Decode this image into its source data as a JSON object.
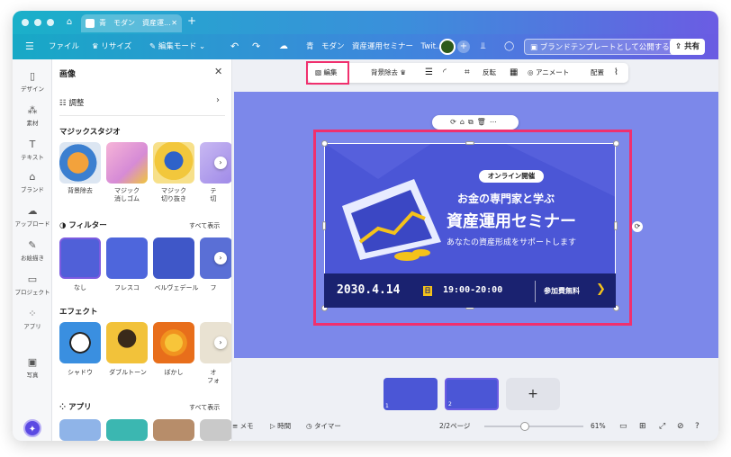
{
  "tab": {
    "title": "青　モダン　資産運..."
  },
  "menubar": {
    "file": "ファイル",
    "resize": "リサイズ",
    "edit_mode": "編集モード",
    "doc_title": "青　モダン　資産運用セミナー　Twit...",
    "publish": "ブランドテンプレートとして公開する",
    "share": "共有"
  },
  "rail": [
    {
      "icon": "layout-icon",
      "label": "デザイン"
    },
    {
      "icon": "elements-icon",
      "label": "素材"
    },
    {
      "icon": "text-icon",
      "label": "テキスト"
    },
    {
      "icon": "brand-icon",
      "label": "ブランド"
    },
    {
      "icon": "upload-icon",
      "label": "アップロード"
    },
    {
      "icon": "draw-icon",
      "label": "お絵描き"
    },
    {
      "icon": "folder-icon",
      "label": "プロジェクト"
    },
    {
      "icon": "apps-icon",
      "label": "アプリ"
    },
    {
      "icon": "photo-icon",
      "label": "写真"
    }
  ],
  "panel": {
    "title": "画像",
    "adjust": "調整",
    "magic_studio": "マジックスタジオ",
    "magic_items": [
      "背景除去",
      "マジック\n消しゴム",
      "マジック\n切り抜き",
      "テ\n切"
    ],
    "filter": "フィルター",
    "filter_see_all": "すべて表示",
    "filter_items": [
      "なし",
      "フレスコ",
      "ベルヴェデール",
      "フ"
    ],
    "effect": "エフェクト",
    "effect_items": [
      "シャドウ",
      "ダブルトーン",
      "ぼかし",
      "オ\nフォ"
    ],
    "apps": "アプリ",
    "apps_see_all": "すべて表示"
  },
  "toolbar": {
    "edit": "編集",
    "bg_remove": "背景除去",
    "flip": "反転",
    "animate": "アニメート",
    "position": "配置"
  },
  "design": {
    "pill": "オンライン開催",
    "subtitle": "お金の専門家と学ぶ",
    "title": "資産運用セミナー",
    "description": "あなたの資産形成をサポートします",
    "date": "2030.4.14",
    "day": "日",
    "time": "19:00-20:00",
    "fee": "参加費無料"
  },
  "pages": {
    "first_num": "1",
    "second_num": "2",
    "add": "+"
  },
  "bottombar": {
    "notes": "メモ",
    "duration": "時間",
    "timer": "タイマー",
    "page_indicator": "2/2ページ",
    "zoom": "61%"
  },
  "colors": {
    "accent": "#f0306e",
    "canvas_bg": "#7c88ea",
    "design_bg": "#4b56d6",
    "strip": "#1a2270",
    "gold": "#f4c21b"
  }
}
